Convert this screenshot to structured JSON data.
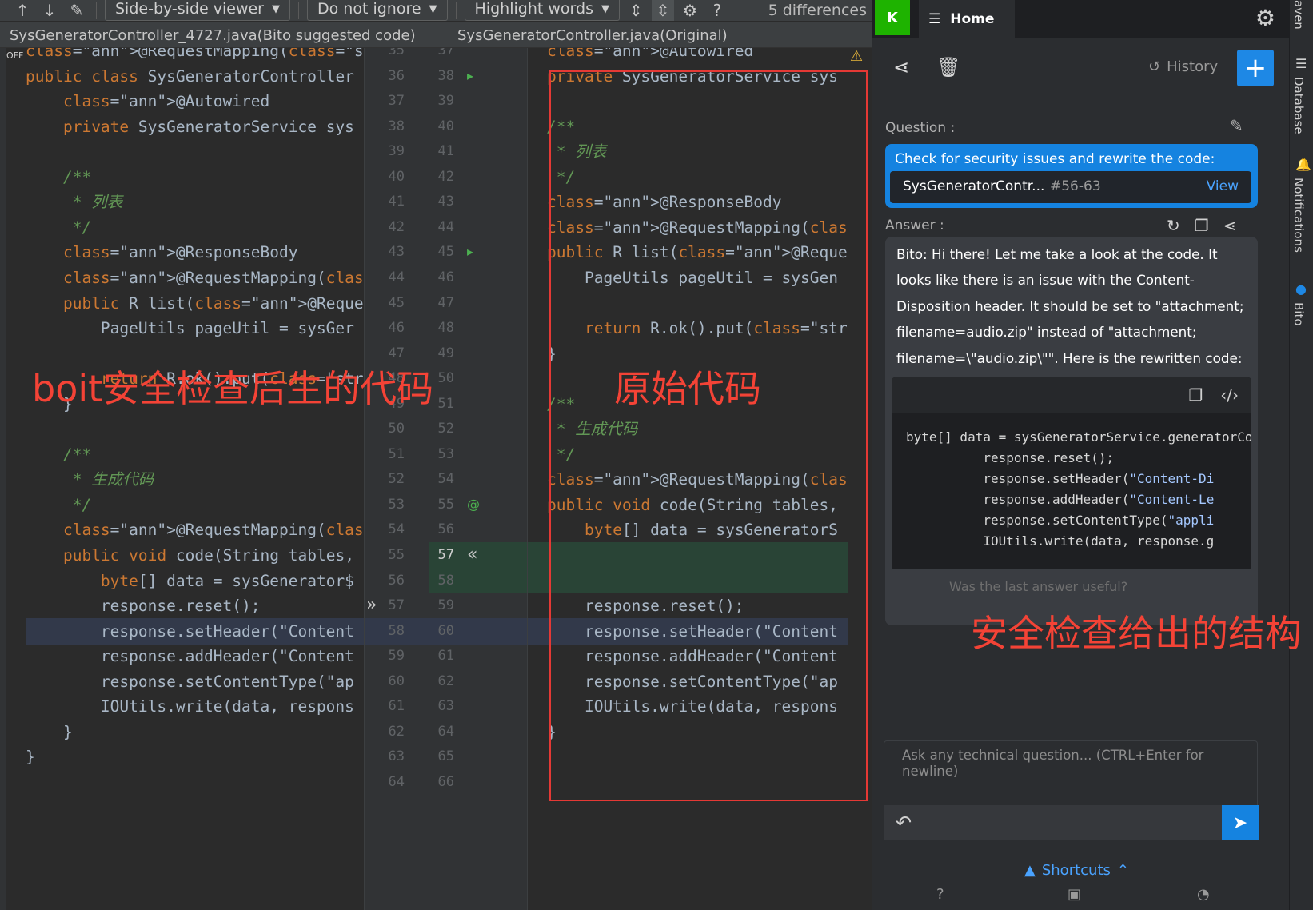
{
  "toolbar": {
    "viewer_mode": "Side-by-side viewer",
    "whitespace_mode": "Do not ignore",
    "highlight_mode": "Highlight words",
    "help_label": "?",
    "diff_count": "5 differences"
  },
  "files": {
    "left_title": "SysGeneratorController_4727.java(Bito suggested code)",
    "right_title": "SysGeneratorController.java(Original)"
  },
  "left_lines": [
    {
      "text": "@RequestMapping(\"/sys/generator\")",
      "kind": "ann"
    },
    {
      "text": "public class SysGeneratorController",
      "kind": "classdecl"
    },
    {
      "text": "    @Autowired",
      "kind": "ann"
    },
    {
      "text": "    private SysGeneratorService sys",
      "kind": "field"
    },
    {
      "text": "",
      "kind": "plain"
    },
    {
      "text": "    /**",
      "kind": "cmt"
    },
    {
      "text": "     * 列表",
      "kind": "cmt"
    },
    {
      "text": "     */",
      "kind": "cmt"
    },
    {
      "text": "    @ResponseBody",
      "kind": "ann"
    },
    {
      "text": "    @RequestMapping(\"/list\")",
      "kind": "annstr"
    },
    {
      "text": "    public R list(@RequestParam Map",
      "kind": "method"
    },
    {
      "text": "        PageUtils pageUtil = sysGer",
      "kind": "plain"
    },
    {
      "text": "",
      "kind": "plain"
    },
    {
      "text": "        return R.ok().put(\"page\", p",
      "kind": "return"
    },
    {
      "text": "    }",
      "kind": "plain"
    },
    {
      "text": "",
      "kind": "plain"
    },
    {
      "text": "    /**",
      "kind": "cmt"
    },
    {
      "text": "     * 生成代码",
      "kind": "cmt"
    },
    {
      "text": "     */",
      "kind": "cmt"
    },
    {
      "text": "    @RequestMapping(\"/code\")",
      "kind": "annstr"
    },
    {
      "text": "    public void code(String tables,",
      "kind": "method"
    },
    {
      "text": "        byte[] data = sysGenerator$",
      "kind": "bytes"
    },
    {
      "text": "        response.reset();",
      "kind": "plain"
    },
    {
      "text": "        response.setHeader(\"Content",
      "kind": "call"
    },
    {
      "text": "        response.addHeader(\"Content",
      "kind": "call"
    },
    {
      "text": "        response.setContentType(\"ap",
      "kind": "call"
    },
    {
      "text": "        IOUtils.write(data, respons",
      "kind": "plain"
    },
    {
      "text": "    }",
      "kind": "plain"
    },
    {
      "text": "}",
      "kind": "plain"
    }
  ],
  "left_line_numbers": [
    "35",
    "36",
    "37",
    "38",
    "39",
    "40",
    "41",
    "42",
    "43",
    "44",
    "45",
    "46",
    "47",
    "48",
    "49",
    "50",
    "51",
    "52",
    "53",
    "54",
    "55",
    "56",
    "57",
    "58",
    "59",
    "60",
    "61",
    "62",
    "63",
    "64"
  ],
  "right_line_numbers": [
    "37",
    "38",
    "39",
    "40",
    "41",
    "42",
    "43",
    "44",
    "45",
    "46",
    "47",
    "48",
    "49",
    "50",
    "51",
    "52",
    "53",
    "54",
    "55",
    "56",
    "57",
    "58",
    "59",
    "60",
    "61",
    "62",
    "63",
    "64",
    "65",
    "66"
  ],
  "right_lines": [
    {
      "text": "@Autowired",
      "kind": "ann"
    },
    {
      "text": "private SysGeneratorService sys",
      "kind": "field"
    },
    {
      "text": "",
      "kind": "plain"
    },
    {
      "text": "/**",
      "kind": "cmt"
    },
    {
      "text": " * 列表",
      "kind": "cmt"
    },
    {
      "text": " */",
      "kind": "cmt"
    },
    {
      "text": "@ResponseBody",
      "kind": "ann"
    },
    {
      "text": "@RequestMapping(\"/list\")",
      "kind": "annstr"
    },
    {
      "text": "public R list(@RequestParam Map",
      "kind": "method"
    },
    {
      "text": "    PageUtils pageUtil = sysGen",
      "kind": "plain"
    },
    {
      "text": "",
      "kind": "plain"
    },
    {
      "text": "    return R.ok().put(\"page\", p",
      "kind": "return"
    },
    {
      "text": "}",
      "kind": "plain"
    },
    {
      "text": "",
      "kind": "plain"
    },
    {
      "text": "/**",
      "kind": "cmt"
    },
    {
      "text": " * 生成代码",
      "kind": "cmt"
    },
    {
      "text": " */",
      "kind": "cmt"
    },
    {
      "text": "@RequestMapping(\"/code\")",
      "kind": "annstr"
    },
    {
      "text": "public void code(String tables,",
      "kind": "method"
    },
    {
      "text": "    byte[] data = sysGeneratorS",
      "kind": "bytes"
    },
    {
      "text": "",
      "kind": "plain"
    },
    {
      "text": "",
      "kind": "plain"
    },
    {
      "text": "    response.reset();",
      "kind": "plain"
    },
    {
      "text": "    response.setHeader(\"Content",
      "kind": "call"
    },
    {
      "text": "    response.addHeader(\"Content",
      "kind": "call"
    },
    {
      "text": "    response.setContentType(\"ap",
      "kind": "call"
    },
    {
      "text": "    IOUtils.write(data, respons",
      "kind": "plain"
    },
    {
      "text": "}",
      "kind": "plain"
    }
  ],
  "overlays": {
    "left_label": "boit安全检查后生的代码",
    "right_label": "原始代码",
    "bito_label": "安全检查给出的结构"
  },
  "bito": {
    "avatar_letter": "K",
    "home_label": "Home",
    "history_label": "History",
    "question_label": "Question :",
    "question_text": "Check for security issues and rewrite the code:",
    "file_name": "SysGeneratorContr...",
    "file_lines": "#56-63",
    "view_label": "View",
    "answer_label": "Answer :",
    "answer_text": "Bito: Hi there! Let me take a look at the code. It looks like there is an issue with the Content-Disposition header. It should be set to \"attachment; filename=audio.zip\" instead of \"attachment; filename=\\\"audio.zip\\\"\". Here is the rewritten code:",
    "code_lines": [
      "byte[] data = sysGeneratorService.generatorCod",
      "          response.reset();",
      "          response.setHeader(\"Content-Di",
      "          response.addHeader(\"Content-Le",
      "          response.setContentType(\"appli",
      "          IOUtils.write(data, response.g"
    ],
    "useful_text": "Was the last answer useful?",
    "ask_placeholder": "Ask any technical question... (CTRL+Enter for newline)",
    "shortcuts_label": "Shortcuts"
  },
  "sidebar_tabs": [
    "aven",
    "Database",
    "Notifications",
    "Bito"
  ],
  "off_label": "OFF"
}
